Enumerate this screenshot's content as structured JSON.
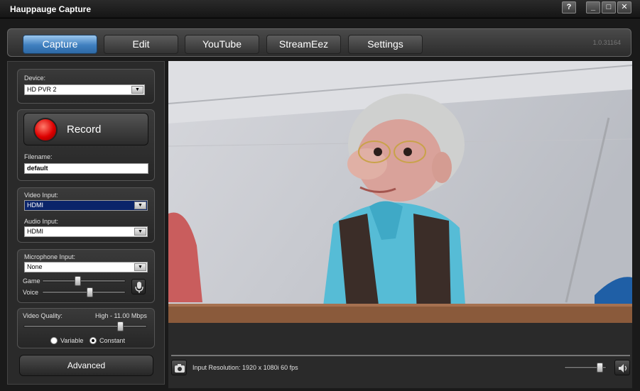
{
  "window": {
    "title": "Hauppauge Capture",
    "controls": [
      "?",
      "_",
      "□",
      "✕"
    ]
  },
  "tabs": [
    {
      "label": "Capture",
      "active": true
    },
    {
      "label": "Edit",
      "active": false
    },
    {
      "label": "YouTube",
      "active": false
    },
    {
      "label": "StreamEez",
      "active": false
    },
    {
      "label": "Settings",
      "active": false
    }
  ],
  "version": "1.0.31164",
  "device": {
    "label": "Device:",
    "value": "HD PVR 2"
  },
  "record": {
    "label": "Record"
  },
  "filename": {
    "label": "Filename:",
    "value": "default"
  },
  "video_input": {
    "label": "Video Input:",
    "value": "HDMI"
  },
  "audio_input": {
    "label": "Audio Input:",
    "value": "HDMI"
  },
  "microphone": {
    "label": "Microphone Input:",
    "value": "None",
    "game_label": "Game",
    "game_level": 0.42,
    "voice_label": "Voice",
    "voice_level": 0.58
  },
  "quality": {
    "label": "Video Quality:",
    "value": "High - 11.00 Mbps",
    "level": 0.8,
    "variable_label": "Variable",
    "constant_label": "Constant",
    "selected": "Constant"
  },
  "advanced": {
    "label": "Advanced"
  },
  "status": {
    "resolution": "Input Resolution: 1920 x 1080i 60 fps",
    "volume_level": 0.9
  },
  "colors": {
    "accent": "#3f7fbf",
    "record": "#dd0000"
  }
}
